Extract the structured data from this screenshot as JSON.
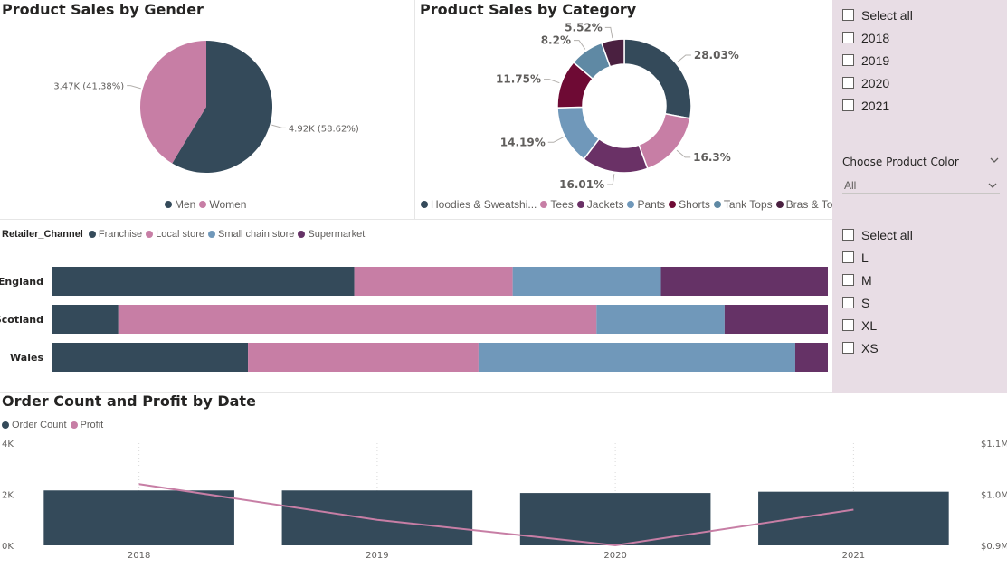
{
  "gender_chart": {
    "title": "Product Sales by Gender",
    "labels": {
      "women": "3.47K (41.38%)",
      "men": "4.92K (58.62%)"
    },
    "legend": [
      {
        "label": "Men",
        "color": "#344a5a"
      },
      {
        "label": "Women",
        "color": "#c77ea5"
      }
    ]
  },
  "category_chart": {
    "title": "Product Sales by Category",
    "legend": [
      {
        "label": "Hoodies & Sweatshi...",
        "color": "#344a5a"
      },
      {
        "label": "Tees",
        "color": "#c77ea5"
      },
      {
        "label": "Jackets",
        "color": "#6a3166"
      },
      {
        "label": "Pants",
        "color": "#7098ba"
      },
      {
        "label": "Shorts",
        "color": "#6e0a34"
      },
      {
        "label": "Tank Tops",
        "color": "#5f89a4"
      },
      {
        "label": "Bras & Tops",
        "color": "#4a2040"
      }
    ]
  },
  "retailer_chart": {
    "legend_title": "Retailer_Channel",
    "legend": [
      {
        "label": "Franchise",
        "color": "#344a5a"
      },
      {
        "label": "Local store",
        "color": "#c77ea5"
      },
      {
        "label": "Small chain store",
        "color": "#7098ba"
      },
      {
        "label": "Supermarket",
        "color": "#653266"
      }
    ]
  },
  "order_chart": {
    "title": "Order Count and Profit by Date",
    "legend": [
      {
        "label": "Order Count",
        "color": "#344a5a"
      },
      {
        "label": "Profit",
        "color": "#c77ea5"
      }
    ]
  },
  "year_slicer": {
    "items": [
      {
        "label": "Select all",
        "checked": false
      },
      {
        "label": "2018",
        "checked": false
      },
      {
        "label": "2019",
        "checked": false
      },
      {
        "label": "2020",
        "checked": false
      },
      {
        "label": "2021",
        "checked": false
      }
    ]
  },
  "color_filter": {
    "title": "Choose Product Color",
    "value": "All",
    "icon": "chevron-down-icon"
  },
  "size_slicer": {
    "items": [
      {
        "label": "Select all",
        "checked": false
      },
      {
        "label": "L",
        "checked": false
      },
      {
        "label": "M",
        "checked": false
      },
      {
        "label": "S",
        "checked": false
      },
      {
        "label": "XL",
        "checked": false
      },
      {
        "label": "XS",
        "checked": false
      }
    ]
  },
  "chart_data": [
    {
      "type": "pie",
      "categories": [
        "Men",
        "Women"
      ],
      "values": [
        4.92,
        3.47
      ],
      "unit": "K",
      "percentages": [
        58.62,
        41.38
      ],
      "colors": [
        "#344a5a",
        "#c77ea5"
      ],
      "title": "Product Sales by Gender",
      "legend_position": "bottom-center"
    },
    {
      "type": "pie",
      "style": "donut",
      "categories": [
        "Hoodies & Sweatshi...",
        "Tees",
        "Jackets",
        "Pants",
        "Shorts",
        "Tank Tops",
        "Bras & Tops"
      ],
      "values": [
        28.03,
        16.3,
        16.01,
        14.19,
        11.75,
        8.2,
        5.52
      ],
      "data_labels": [
        "28.03%",
        "16.3%",
        "16.01%",
        "14.19%",
        "11.75%",
        "8.2%",
        "5.52%"
      ],
      "colors": [
        "#344a5a",
        "#c77ea5",
        "#6a3166",
        "#7098ba",
        "#6e0a34",
        "#5f89a4",
        "#4a2040"
      ],
      "title": "Product Sales by Category",
      "legend_position": "bottom"
    },
    {
      "type": "bar",
      "orientation": "horizontal",
      "stacked": "100%",
      "categories": [
        "England",
        "Scotland",
        "Wales"
      ],
      "series": [
        {
          "name": "Franchise",
          "values": [
            39,
            8.6,
            25.3
          ]
        },
        {
          "name": "Local store",
          "values": [
            20.4,
            61.6,
            29.7
          ]
        },
        {
          "name": "Small chain store",
          "values": [
            19.1,
            16.5,
            40.8
          ]
        },
        {
          "name": "Supermarket",
          "values": [
            21.5,
            13.3,
            4.2
          ]
        }
      ],
      "colors": [
        "#344a5a",
        "#c77ea5",
        "#7098ba",
        "#653266"
      ],
      "legend_title": "Retailer_Channel",
      "legend_position": "top-left"
    },
    {
      "type": "bar",
      "combo": "bar+line",
      "categories": [
        "2018",
        "2019",
        "2020",
        "2021"
      ],
      "series": [
        {
          "name": "Order Count",
          "type": "bar",
          "axis": "left",
          "values": [
            2150,
            2150,
            2050,
            2100
          ]
        },
        {
          "name": "Profit",
          "type": "line",
          "axis": "right",
          "values": [
            1.02,
            0.95,
            0.9,
            0.97
          ]
        }
      ],
      "colors": [
        "#344a5a",
        "#c77ea5"
      ],
      "title": "Order Count and Profit by Date",
      "y_ticks": [
        "0K",
        "2K",
        "4K"
      ],
      "ylim": [
        0,
        4000
      ],
      "y2_ticks": [
        "$0.9M",
        "$1.0M",
        "$1.1M"
      ],
      "y2lim": [
        0.9,
        1.1
      ],
      "grid": "vertical dotted",
      "legend_position": "top-left"
    }
  ]
}
